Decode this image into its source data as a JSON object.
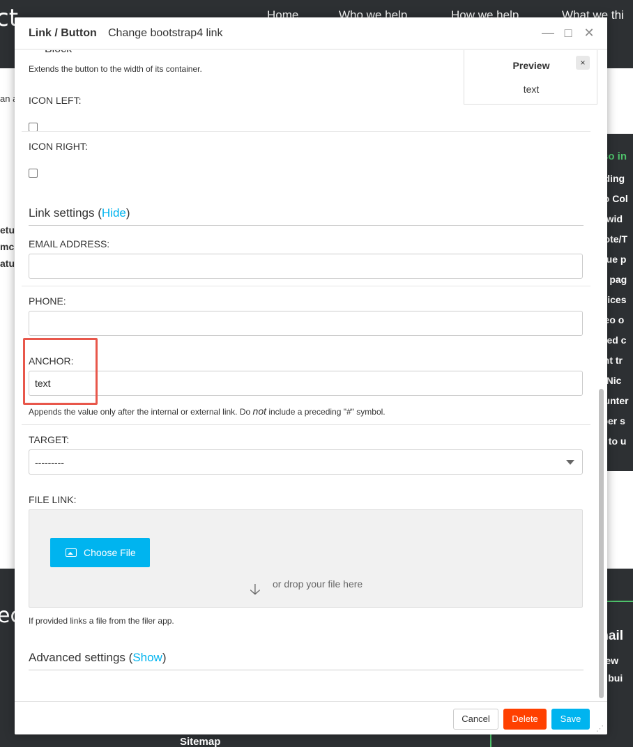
{
  "background": {
    "logo": "ct",
    "nav": [
      "Home",
      "Who we help",
      "How we help",
      "What we thi"
    ],
    "left_fragments": [
      "an a",
      "etur",
      "mc",
      "atu"
    ],
    "sidebar_title": "so in",
    "sidebar_items": [
      "nding",
      "vo Col",
      "ll wid",
      "uote/T",
      "alue p",
      "st pag",
      "rvices",
      "deo o",
      "ated c",
      "ent tr",
      "k Nic",
      "ounter",
      "rber s",
      "w to u"
    ],
    "footer_logo": "ect",
    "footer_heading": "mail",
    "footer_lines": [
      ", new",
      "ed bui"
    ],
    "sitemap": "Sitemap"
  },
  "modal": {
    "title": "Link / Button",
    "subtitle": "Change bootstrap4 link",
    "controls": {
      "minimize": "—",
      "maximize": "□",
      "close": "✕"
    },
    "block_partial": "Block",
    "block_help": "Extends the button to the width of its container.",
    "icon_left_label": "ICON LEFT:",
    "icon_right_label": "ICON RIGHT:",
    "link_settings": {
      "label": "Link settings",
      "toggle": "Hide"
    },
    "email_label": "EMAIL ADDRESS:",
    "email_value": "",
    "phone_label": "PHONE:",
    "phone_value": "",
    "anchor_label": "ANCHOR:",
    "anchor_value": "text",
    "anchor_help_before": "Appends the value only after the internal or external link. Do ",
    "anchor_help_em": "not",
    "anchor_help_after": " include a preceding \"#\" symbol.",
    "target_label": "TARGET:",
    "target_value": "---------",
    "file_link_label": "FILE LINK:",
    "choose_file": "Choose File",
    "drop_text": "or drop your file here",
    "file_help": "If provided links a file from the filer app.",
    "advanced_settings": {
      "label": "Advanced settings",
      "toggle": "Show"
    },
    "preview": {
      "title": "Preview",
      "text": "text",
      "close": "×"
    },
    "footer": {
      "cancel": "Cancel",
      "delete": "Delete",
      "save": "Save"
    }
  },
  "colors": {
    "accent": "#00b4ef",
    "danger": "#ff4000",
    "highlight": "#e8574b",
    "site_dark": "#2d3033",
    "site_green": "#4ec26b"
  }
}
